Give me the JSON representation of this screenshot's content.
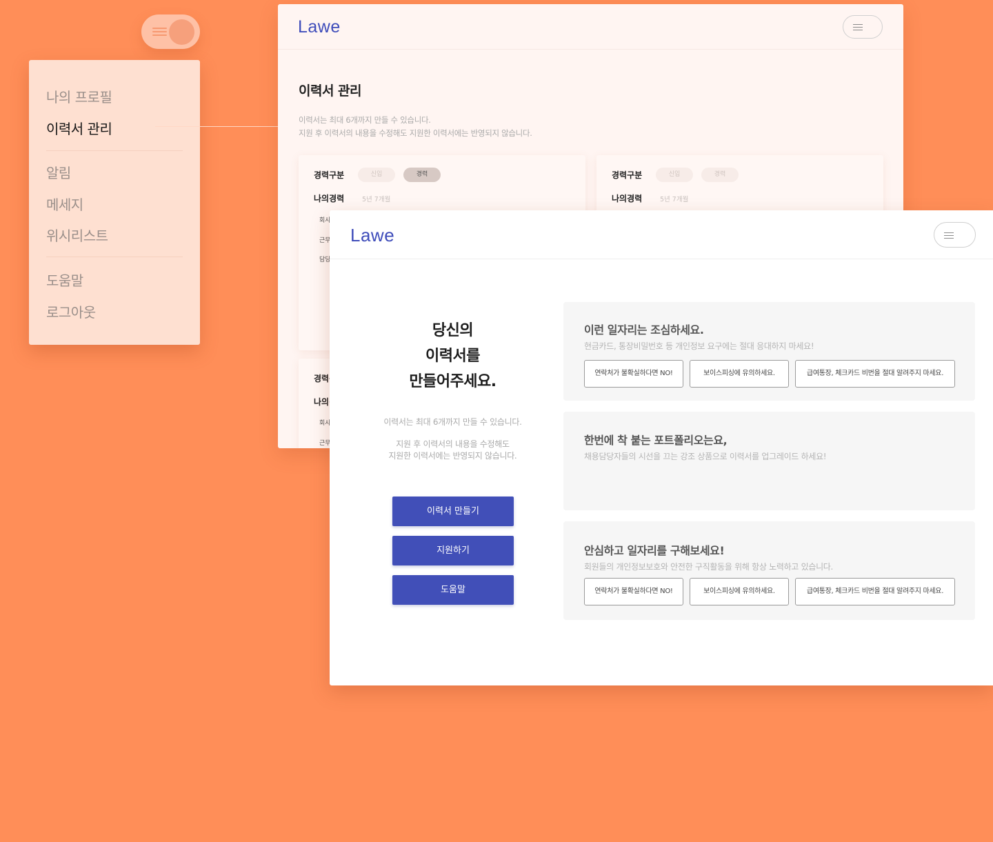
{
  "sidemenu": {
    "items": [
      "나의 프로필",
      "이력서 관리",
      "알림",
      "메세지",
      "위시리스트",
      "도움말",
      "로그아웃"
    ]
  },
  "back_window": {
    "logo": "Lawe",
    "title": "이력서 관리",
    "desc": [
      "이력서는 최대 6개까지 만들 수 있습니다.",
      "지원 후 이력서의 내용을 수정해도 지원한 이력서에는 반영되지 않습니다."
    ],
    "card": {
      "career_label": "경력구분",
      "pill_new": "신입",
      "pill_exp": "경력",
      "my_career_label": "나의경력",
      "my_career_value": "5년 7개월",
      "row_company": "회사",
      "row_work": "근무",
      "row_duty": "담당"
    }
  },
  "front_window": {
    "logo": "Lawe",
    "hero": [
      "당신의",
      "이력서를",
      "만들어주세요."
    ],
    "desc1": "이력서는 최대 6개까지 만들 수 있습니다.",
    "desc2": [
      "지원 후 이력서의 내용을 수정해도",
      "지원한 이력서에는 반영되지 않습니다."
    ],
    "buttons": [
      "이력서 만들기",
      "지원하기",
      "도움말"
    ],
    "cards": [
      {
        "title": "이런 일자리는 조심하세요.",
        "sub": "현금카드, 통장비밀번호 등 개인정보 요구에는 절대 응대하지 마세요!",
        "chips": [
          "연락처가 불확실하다면 NO!",
          "보이스피싱에 유의하세요.",
          "급여통장, 체크카드 비번을 절대 알려주지 마세요."
        ]
      },
      {
        "title": "한번에 착 붙는 포트폴리오는요,",
        "sub": "채용담당자들의 시선을 끄는 강조 상품으로 이력서를 업그레이드 하세요!"
      },
      {
        "title": "안심하고 일자리를 구해보세요!",
        "sub": "회원들의 개인정보보호와 안전한 구직활동을 위해 항상 노력하고 있습니다.",
        "chips": [
          "연락처가 불확실하다면 NO!",
          "보이스피싱에 유의하세요.",
          "급여통장, 체크카드 비번을 절대 알려주지 마세요."
        ]
      }
    ]
  },
  "colors": {
    "background": "#ff8e58",
    "brand": "#3e4cba",
    "button": "#414fb8"
  }
}
